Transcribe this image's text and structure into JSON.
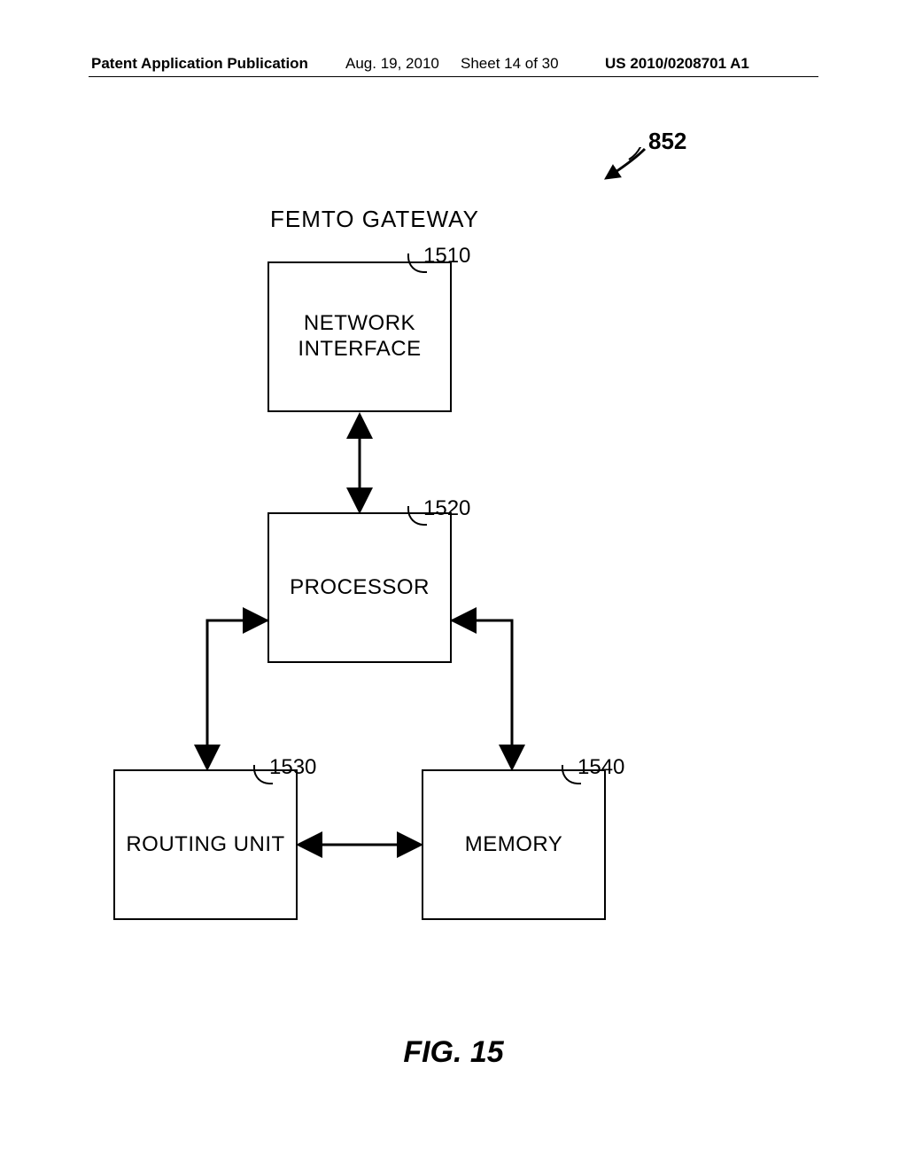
{
  "header": {
    "publication": "Patent Application Publication",
    "date": "Aug. 19, 2010",
    "sheet": "Sheet 14 of 30",
    "patno": "US 2010/0208701 A1"
  },
  "figure": {
    "ref_top": "852",
    "title": "FEMTO GATEWAY",
    "caption": "FIG. 15",
    "boxes": {
      "network_interface": {
        "label_line1": "NETWORK",
        "label_line2": "INTERFACE",
        "ref": "1510"
      },
      "processor": {
        "label": "PROCESSOR",
        "ref": "1520"
      },
      "routing_unit": {
        "label": "ROUTING UNIT",
        "ref": "1530"
      },
      "memory": {
        "label": "MEMORY",
        "ref": "1540"
      }
    }
  }
}
